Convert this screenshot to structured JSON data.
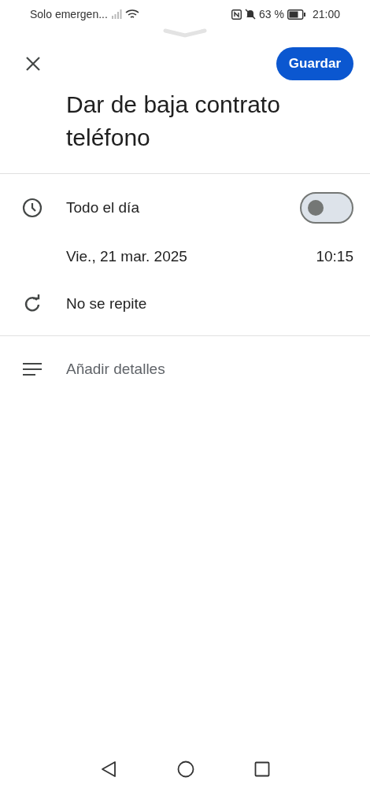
{
  "status_bar": {
    "carrier": "Solo emergen...",
    "battery_percent": "63 %",
    "time": "21:00"
  },
  "header": {
    "save_button": "Guardar"
  },
  "event": {
    "title": "Dar de baja contrato teléfono"
  },
  "all_day": {
    "label": "Todo el día",
    "on": false
  },
  "start": {
    "date": "Vie., 21 mar. 2025",
    "time": "10:15"
  },
  "repeat": {
    "label": "No se repite"
  },
  "details": {
    "placeholder": "Añadir detalles"
  }
}
